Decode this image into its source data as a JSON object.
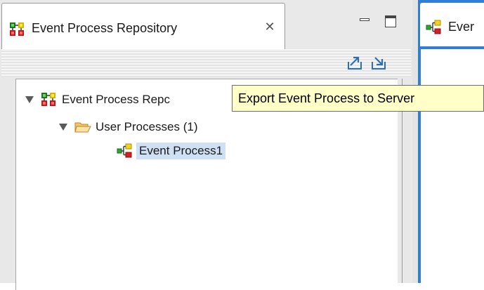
{
  "left_view": {
    "tab_title": "Event Process Repository",
    "icons": {
      "tab": "event-process-repository-icon",
      "close": "close-icon",
      "minimize": "minimize-icon",
      "maximize": "maximize-icon",
      "export": "export-to-server-icon",
      "import": "import-from-server-icon"
    },
    "tree": [
      {
        "label": "Event Process Repc",
        "icon": "repository-icon",
        "expanded": true
      },
      {
        "label": "User Processes (1)",
        "icon": "folder-open-icon",
        "expanded": true
      },
      {
        "label": "Event Process1",
        "icon": "event-process-icon",
        "selected": true
      }
    ]
  },
  "tooltip": {
    "text": "Export Event Process to Server"
  },
  "right_view": {
    "tab_title": "Ever",
    "icon": "event-process-icon"
  },
  "colors": {
    "selection": "#cfe0f5",
    "tooltip_bg": "#ffffc8",
    "active_editor": "#2f7fd6"
  }
}
